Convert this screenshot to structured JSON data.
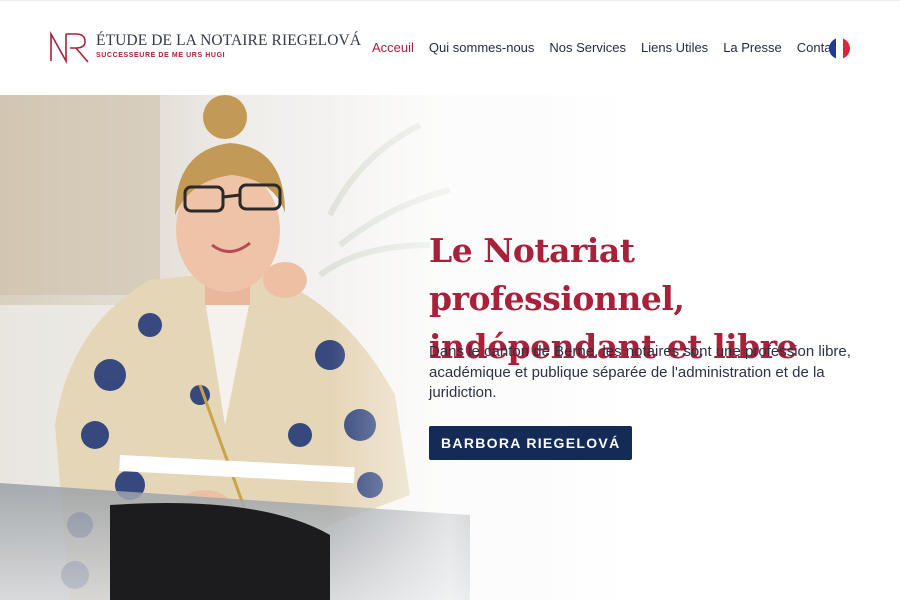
{
  "header": {
    "logo": {
      "monogram": "NR",
      "title": "ÉTUDE DE LA NOTAIRE RIEGELOVÁ",
      "subtitle": "SUCCESSEURE DE ME URS HUGI"
    },
    "nav": [
      {
        "label": "Acceuil",
        "active": true
      },
      {
        "label": "Qui sommes-nous",
        "active": false
      },
      {
        "label": "Nos Services",
        "active": false
      },
      {
        "label": "Liens Utiles",
        "active": false
      },
      {
        "label": "La Presse",
        "active": false
      },
      {
        "label": "Contact",
        "active": false
      }
    ],
    "language_flag": "french-flag-icon"
  },
  "hero": {
    "title_line1": "Le Notariat professionnel,",
    "title_line2": "indépendant et libre",
    "text": "Dans le canton de Berne, les notaires sont une profession libre, académique et publique séparée de l'administration et de la juridiction.",
    "button_label": "BARBORA RIEGELOVÁ"
  },
  "colors": {
    "accent": "#a8213a",
    "navy": "#142a57",
    "text": "#2b3245"
  }
}
